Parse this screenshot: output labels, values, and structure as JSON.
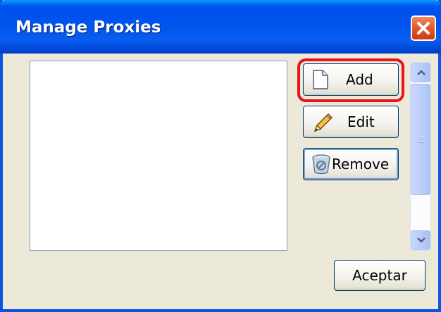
{
  "window": {
    "title": "Manage Proxies",
    "close_icon": "close-icon"
  },
  "buttons": {
    "add_label": "Add",
    "add_icon": "document-icon",
    "edit_label": "Edit",
    "edit_icon": "pencil-icon",
    "remove_label": "Remove",
    "remove_icon": "recycle-bin-icon",
    "ok_label": "Aceptar"
  },
  "proxy_list": {
    "items": []
  },
  "colors": {
    "titlebar": "#0054e3",
    "dialog_bg": "#ece9d8",
    "highlight": "#e8141c",
    "close_button": "#e2582d"
  }
}
